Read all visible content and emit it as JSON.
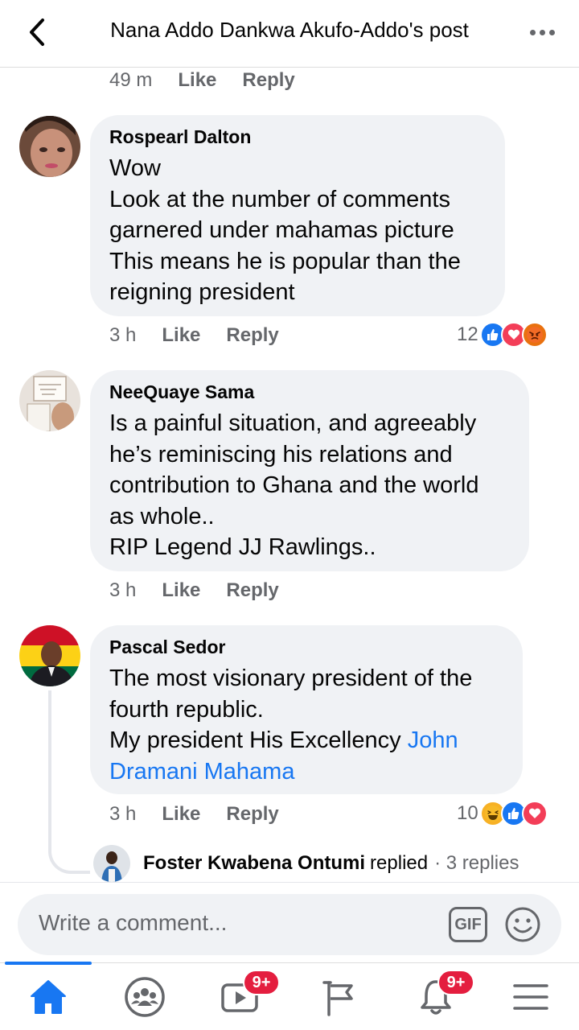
{
  "header": {
    "title": "Nana Addo Dankwa Akufo-Addo's post"
  },
  "top_meta": {
    "time": "49 m",
    "like": "Like",
    "reply": "Reply"
  },
  "comments": [
    {
      "author": "Rospearl Dalton",
      "lines": [
        "Wow",
        "Look at the number of comments",
        "garnered under mahamas picture",
        "This means he is popular than the",
        "reigning president"
      ],
      "time": "3 h",
      "like": "Like",
      "reply": "Reply",
      "reaction_count": "12",
      "reactions": [
        "like-icon",
        "love-icon",
        "angry-icon"
      ]
    },
    {
      "author": "NeeQuaye Sama",
      "lines": [
        "Is a painful situation, and agreeably",
        "he’s reminiscing his relations and",
        "contribution to Ghana and the world",
        "as whole..",
        "RIP Legend JJ Rawlings.."
      ],
      "time": "3 h",
      "like": "Like",
      "reply": "Reply"
    },
    {
      "author": "Pascal Sedor",
      "lines": [
        "The most visionary president of the",
        "fourth republic.",
        "My president His Excellency "
      ],
      "mention_part1": "John",
      "mention_part2": "Dramani Mahama",
      "time": "3 h",
      "like": "Like",
      "reply": "Reply",
      "reaction_count": "10",
      "reactions": [
        "haha-icon",
        "like-icon",
        "love-icon"
      ],
      "replies": {
        "name": "Foster Kwabena Ontumi",
        "word": "replied",
        "count": "· 3 replies"
      }
    }
  ],
  "composer": {
    "placeholder": "Write a comment...",
    "gif": "GIF"
  },
  "nav": {
    "items": [
      "home-icon",
      "groups-icon",
      "watch-icon",
      "pages-icon",
      "notifications-icon",
      "menu-icon"
    ],
    "watch_badge": "9+",
    "notif_badge": "9+"
  },
  "colors": {
    "accent": "#1877f2",
    "badge": "#e41e3f",
    "bubble": "#f0f2f5",
    "muted": "#65676b"
  }
}
